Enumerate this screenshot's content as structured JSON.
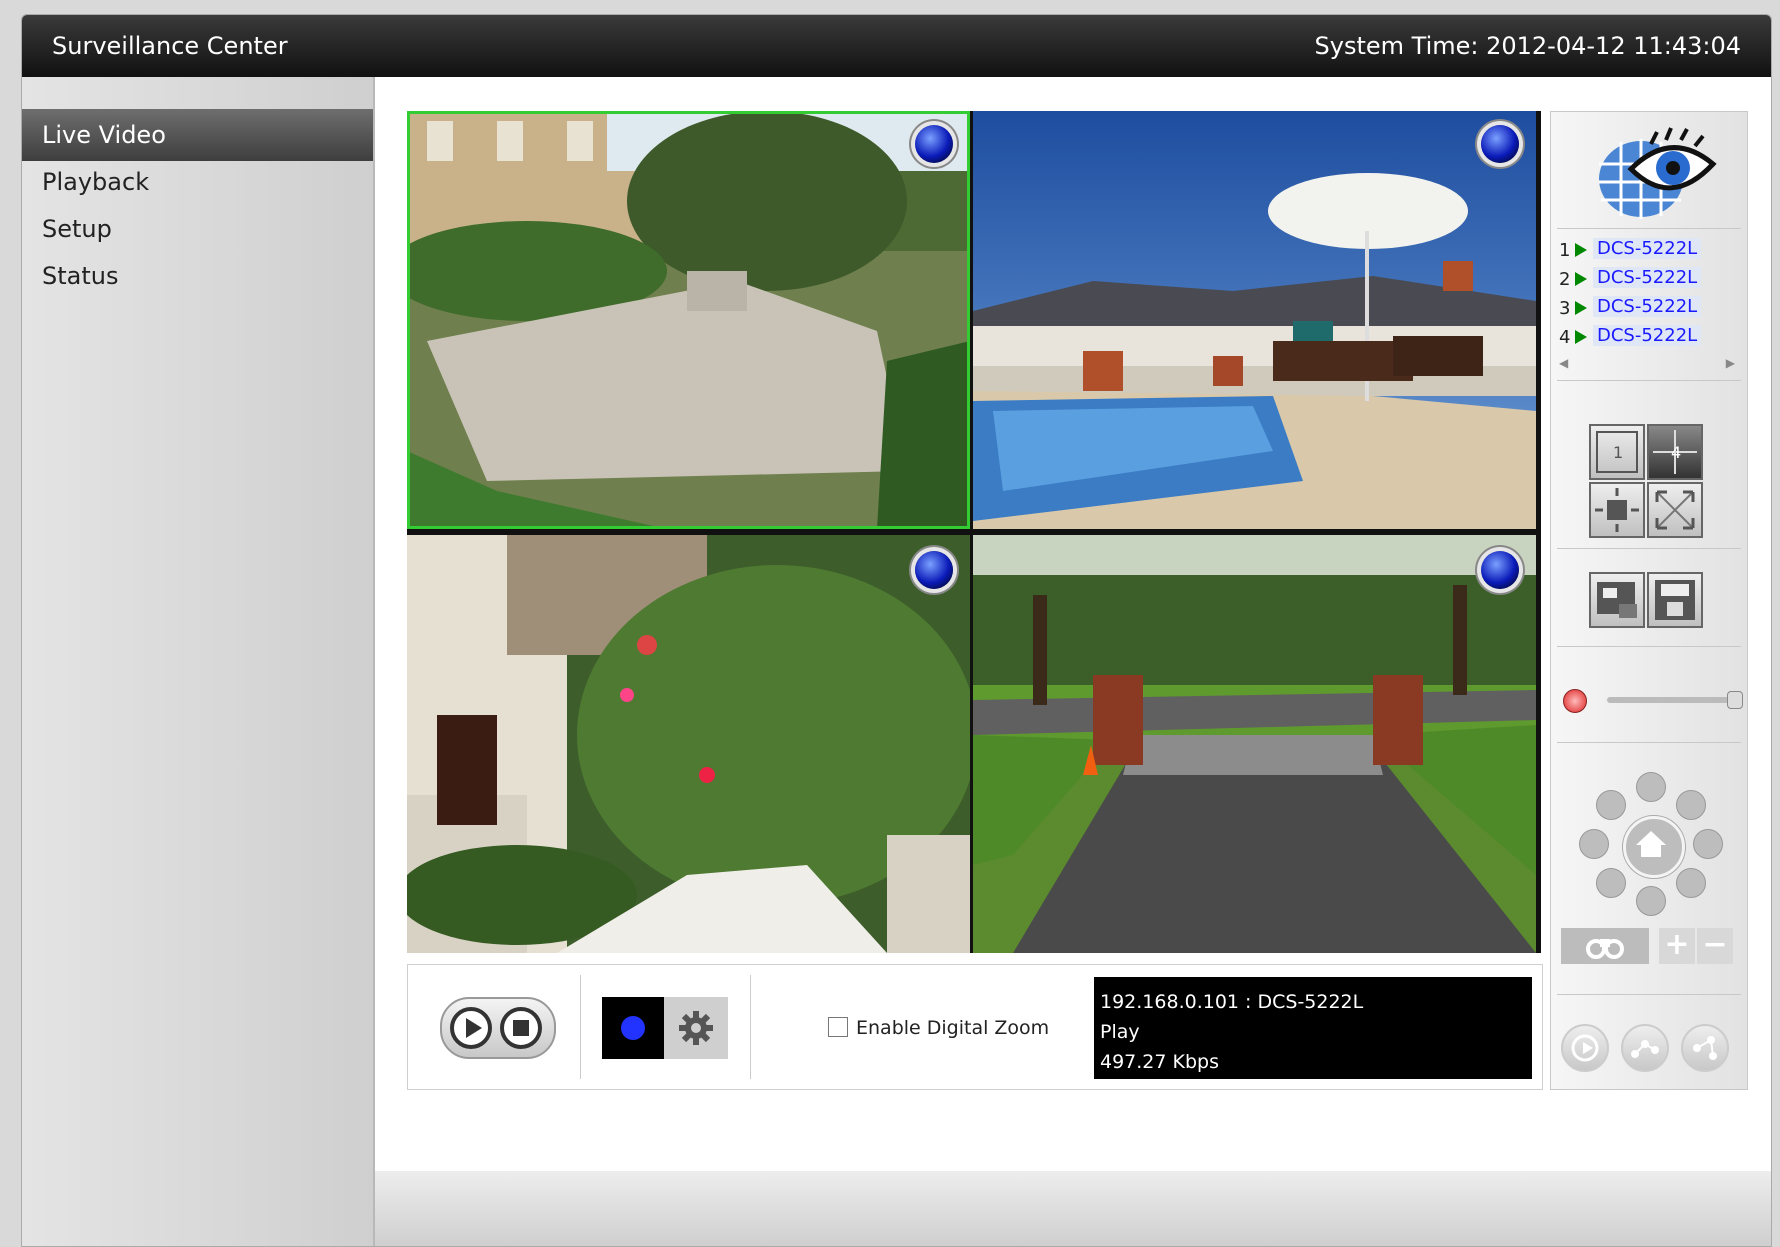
{
  "header": {
    "title": "Surveillance Center",
    "system_time": "System Time: 2012-04-12 11:43:04"
  },
  "sidebar": {
    "items": [
      {
        "label": "Live Video",
        "active": true
      },
      {
        "label": "Playback",
        "active": false
      },
      {
        "label": "Setup",
        "active": false
      },
      {
        "label": "Status",
        "active": false
      }
    ]
  },
  "cameras": [
    {
      "num": "1",
      "name": "DCS-5222L"
    },
    {
      "num": "2",
      "name": "DCS-5222L"
    },
    {
      "num": "3",
      "name": "DCS-5222L"
    },
    {
      "num": "4",
      "name": "DCS-5222L"
    }
  ],
  "controls": {
    "digital_zoom_label": "Enable Digital Zoom",
    "digital_zoom_checked": false
  },
  "info": {
    "line1": "192.168.0.101 : DCS-5222L",
    "line2": "Play",
    "line3": "497.27 Kbps"
  },
  "colors": {
    "titlebar": "#111111",
    "selected_border": "#33cc33",
    "record_blue": "#2233ff",
    "camera_link": "#1a1aff"
  }
}
